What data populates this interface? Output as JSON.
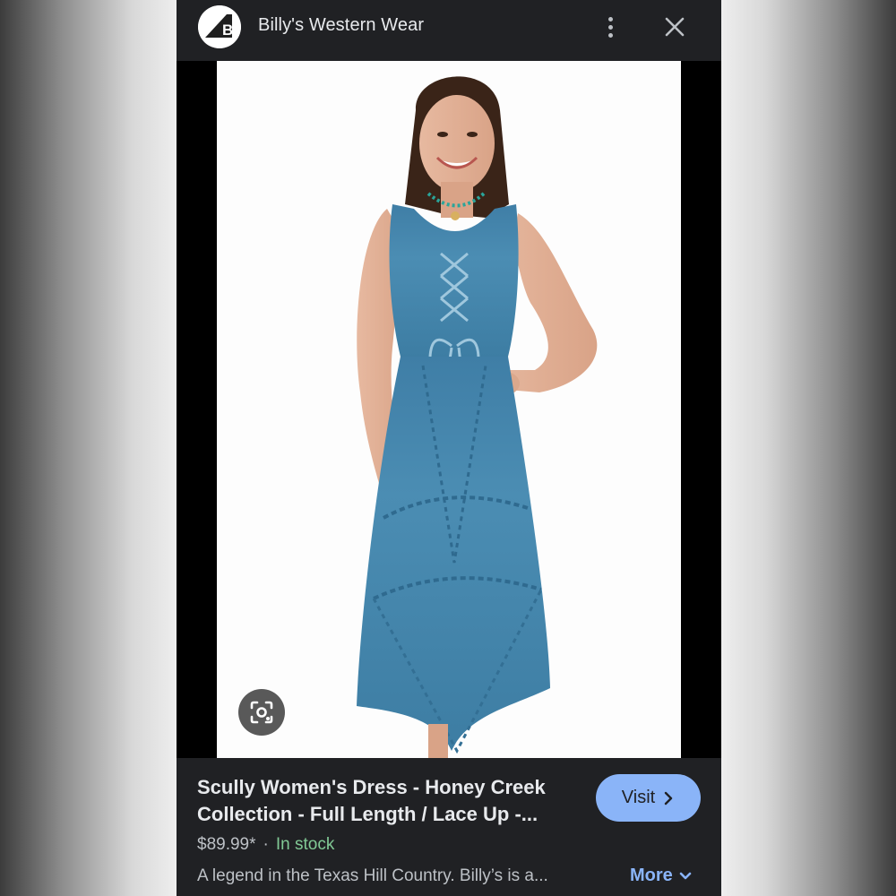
{
  "header": {
    "logo_letter": "B",
    "site_name": "Billy's Western Wear",
    "icons": {
      "menu": "more-vert-icon",
      "close": "close-icon"
    }
  },
  "image": {
    "alt": "Woman wearing a blue embroidered lace-up sleeveless dress",
    "lens_icon": "google-lens-icon"
  },
  "product": {
    "title": "Scully Women's Dress - Honey Creek Collection - Full Length / Lace Up -...",
    "price": "$89.99*",
    "separator": "·",
    "availability": "In stock",
    "description": "A legend in the Texas Hill Country. Billy’s is a...",
    "visit_label": "Visit",
    "more_label": "More"
  },
  "colors": {
    "panel_bg": "#202124",
    "accent": "#8ab4f8",
    "stock_green": "#81c995",
    "dress_blue": "#4a88ad"
  }
}
